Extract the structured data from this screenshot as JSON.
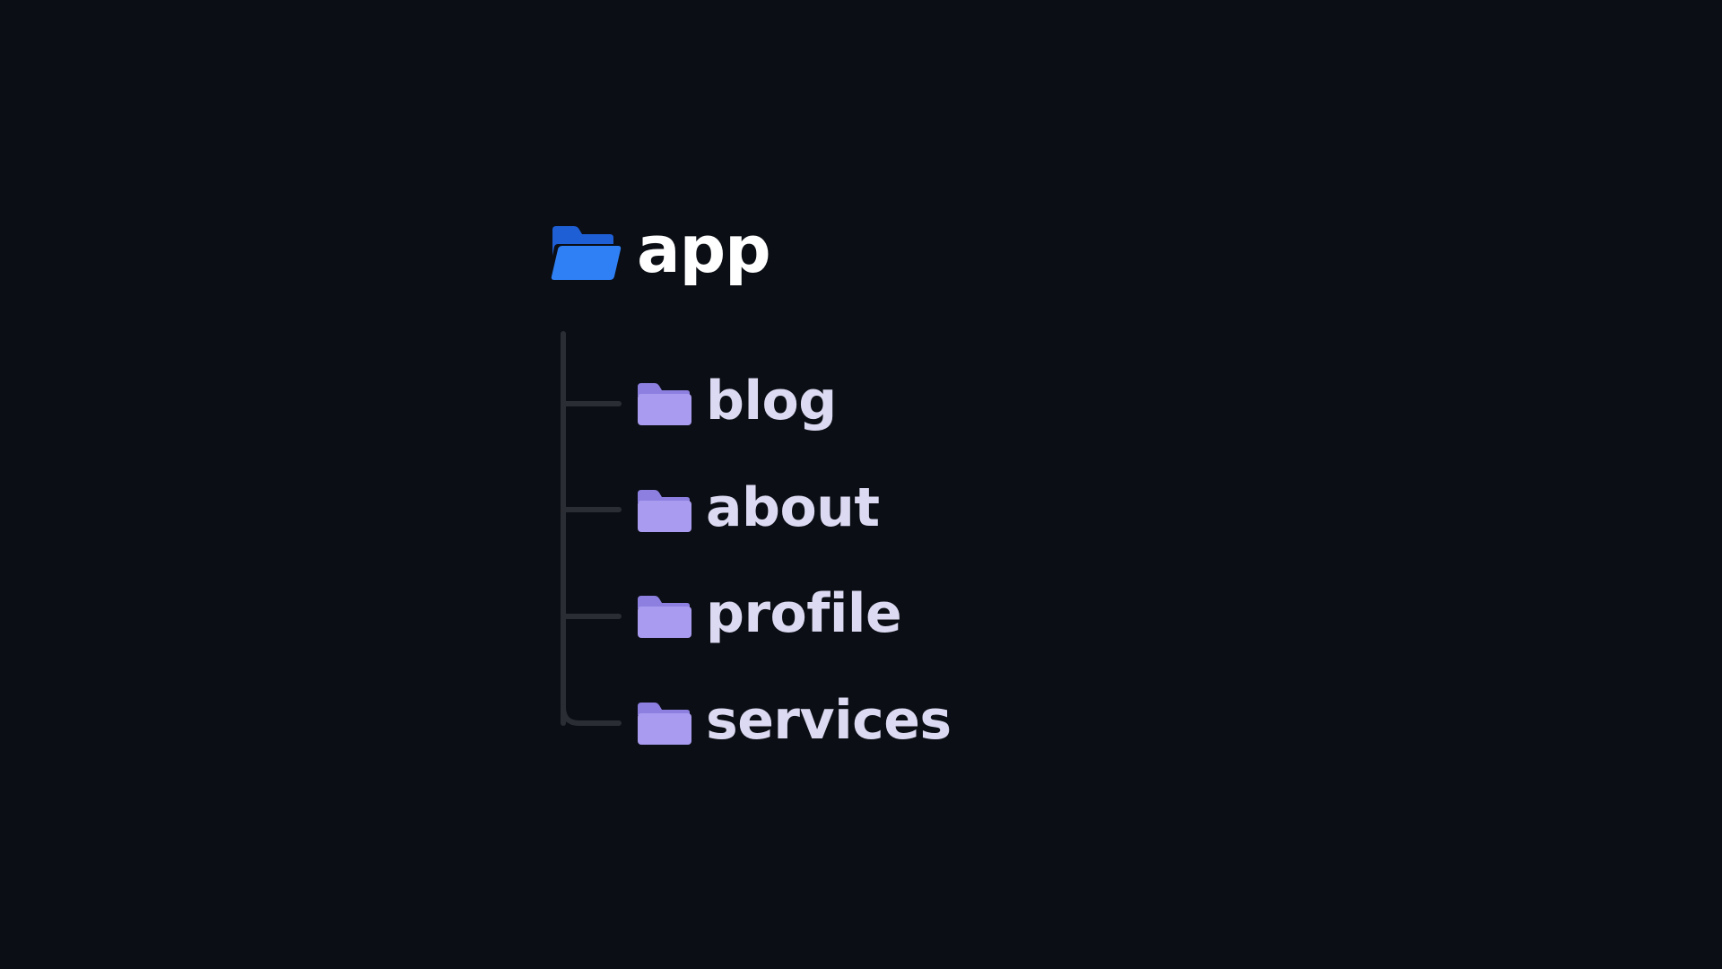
{
  "root": {
    "label": "app",
    "icon": "folder-open-icon",
    "color": "#2f80f5"
  },
  "children": [
    {
      "label": "blog",
      "icon": "folder-icon"
    },
    {
      "label": "about",
      "icon": "folder-icon"
    },
    {
      "label": "profile",
      "icon": "folder-icon"
    },
    {
      "label": "services",
      "icon": "folder-icon"
    }
  ],
  "colors": {
    "background": "#0b0e14",
    "root_text": "#ffffff",
    "child_text": "#dcdaf2",
    "child_folder": "#a99cf0",
    "connector": "#2a2d33"
  }
}
